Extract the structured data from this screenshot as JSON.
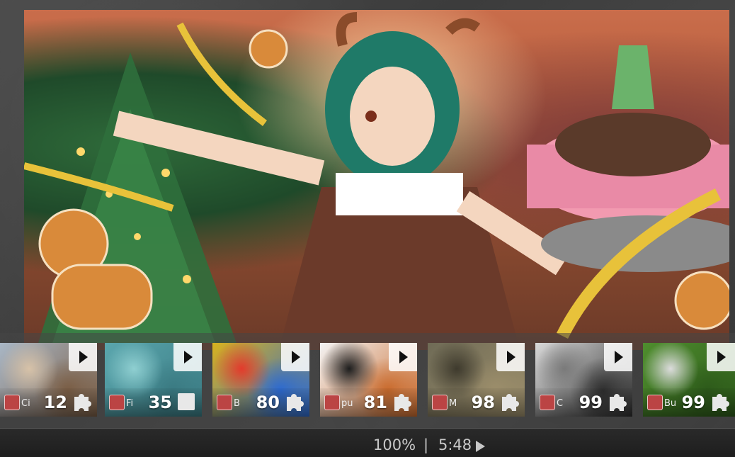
{
  "puzzle": {
    "image_alt": "Christmas anime girl puzzle artwork"
  },
  "thumbnails": [
    {
      "author": "Ci",
      "count": "12",
      "piece_style": "jigsaw",
      "colors": [
        "#a9b7c6",
        "#d7c2a8",
        "#7a5d44"
      ]
    },
    {
      "author": "Fi",
      "count": "35",
      "piece_style": "square",
      "colors": [
        "#5aa6ad",
        "#8fcfd1",
        "#3a7a82"
      ]
    },
    {
      "author": "B",
      "count": "80",
      "piece_style": "jigsaw",
      "colors": [
        "#d8b21e",
        "#e33b2c",
        "#2c6ad1"
      ]
    },
    {
      "author": "pu",
      "count": "81",
      "piece_style": "jigsaw",
      "colors": [
        "#f3f3f3",
        "#1d1d1d",
        "#c96a2c"
      ]
    },
    {
      "author": "M",
      "count": "98",
      "piece_style": "jigsaw",
      "colors": [
        "#6f6b56",
        "#3e3a2d",
        "#9c8e6b"
      ]
    },
    {
      "author": "C",
      "count": "99",
      "piece_style": "jigsaw",
      "colors": [
        "#d9d9d9",
        "#7a7a7a",
        "#2e2e2e"
      ]
    },
    {
      "author": "Bu",
      "count": "99",
      "piece_style": "jigsaw",
      "colors": [
        "#4f8e2e",
        "#dcdcdc",
        "#2d5a1a"
      ]
    }
  ],
  "status": {
    "zoom": "100%",
    "separator": "|",
    "timer": "5:48"
  }
}
